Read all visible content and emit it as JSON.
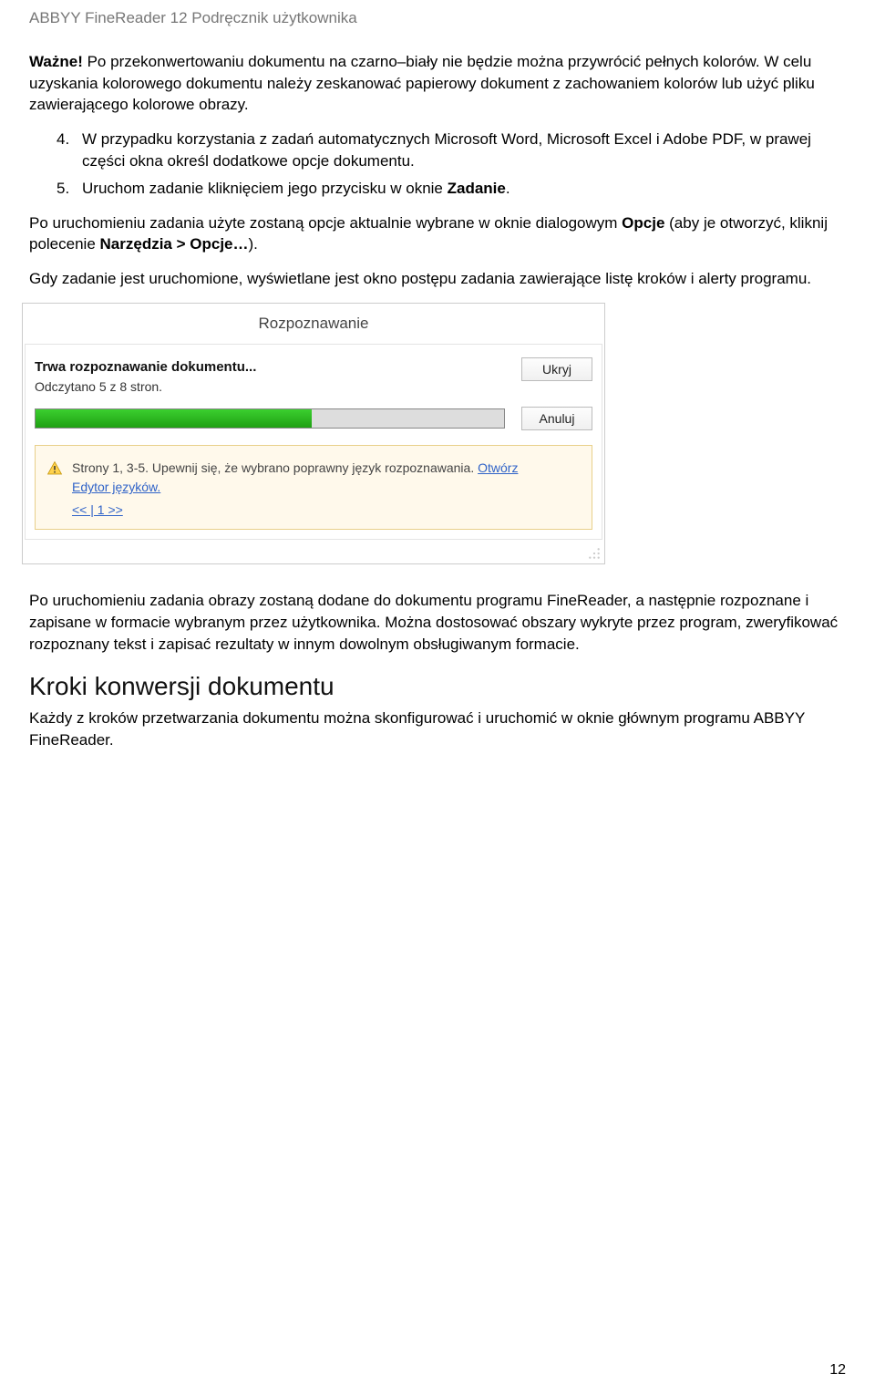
{
  "header": "ABBYY FineReader 12 Podręcznik użytkownika",
  "para1_bold": "Ważne!",
  "para1_rest": " Po przekonwertowaniu dokumentu na czarno–biały nie będzie można przywrócić pełnych kolorów. W celu uzyskania kolorowego dokumentu należy zeskanować papierowy dokument z zachowaniem kolorów lub użyć pliku zawierającego kolorowe obrazy.",
  "list": [
    {
      "num": "4.",
      "text": "W przypadku korzystania z zadań automatycznych Microsoft Word, Microsoft Excel i Adobe PDF, w prawej części okna określ dodatkowe opcje dokumentu."
    },
    {
      "num": "5.",
      "prefix": "Uruchom zadanie kliknięciem jego przycisku w oknie ",
      "bold": "Zadanie",
      "suffix": "."
    }
  ],
  "para2a": "Po uruchomieniu zadania użyte zostaną opcje aktualnie wybrane w oknie dialogowym ",
  "para2b": "Opcje",
  "para2c": " (aby je otworzyć, kliknij polecenie ",
  "para2d": "Narzędzia > Opcje…",
  "para2e": ").",
  "para3": "Gdy zadanie jest uruchomione, wyświetlane jest okno postępu zadania zawierające listę kroków i alerty programu.",
  "dialog": {
    "title": "Rozpoznawanie",
    "status_main": "Trwa rozpoznawanie dokumentu...",
    "status_sub": "Odczytano 5 z 8 stron.",
    "btn_hide": "Ukryj",
    "btn_cancel": "Anuluj",
    "alert_text": "Strony 1, 3-5. Upewnij się, że wybrano poprawny język rozpoznawania. ",
    "alert_link1": "Otwórz",
    "alert_link2": "Edytor języków.",
    "pager": "<< | 1 >>"
  },
  "para4": "Po uruchomieniu zadania obrazy zostaną dodane do dokumentu programu FineReader, a następnie rozpoznane i zapisane w formacie wybranym przez użytkownika. Można dostosować obszary wykryte przez program, zweryfikować rozpoznany tekst i zapisać rezultaty w innym dowolnym obsługiwanym formacie.",
  "section_title": "Kroki konwersji dokumentu",
  "para5": "Każdy z kroków przetwarzania dokumentu można skonfigurować i uruchomić w oknie głównym programu ABBYY FineReader.",
  "page_number": "12"
}
